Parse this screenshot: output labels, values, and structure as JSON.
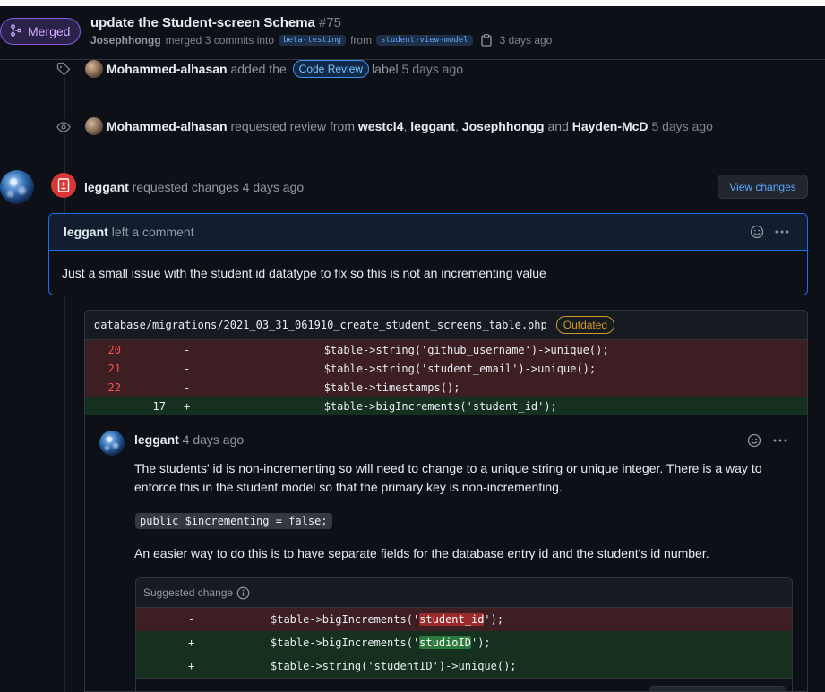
{
  "pr": {
    "state_label": "Merged",
    "title": "update the Student-screen Schema",
    "number": "#75",
    "author": "Josephhongg",
    "merge_text": "merged 3 commits into",
    "base_branch": "beta-testing",
    "from_text": "from",
    "head_branch": "student-view-model",
    "time": "3 days ago"
  },
  "events": [
    {
      "user": "Mohammed-alhasan",
      "action": "added the",
      "label": "Code Review",
      "suffix": "label",
      "time": "5 days ago",
      "icon": "tag-icon"
    },
    {
      "user": "Mohammed-alhasan",
      "action": "requested review from",
      "reviewers": [
        "westcl4",
        "leggant",
        "Josephhongg"
      ],
      "and_text": "and",
      "last_reviewer": "Hayden-McD",
      "time": "5 days ago",
      "icon": "eye-icon"
    }
  ],
  "review": {
    "user": "leggant",
    "action": "requested changes",
    "time": "4 days ago",
    "view_changes_label": "View changes",
    "comment": {
      "user": "leggant",
      "action": "left a comment",
      "body": "Just a small issue with the student id datatype to fix so this is not an incrementing value"
    }
  },
  "diff": {
    "file": "database/migrations/2021_03_31_061910_create_student_screens_table.php",
    "outdated_label": "Outdated",
    "lines": [
      {
        "type": "del",
        "old": "20",
        "new": "",
        "sign": "-",
        "code": "            $table->string('github_username')->unique();"
      },
      {
        "type": "del",
        "old": "21",
        "new": "",
        "sign": "-",
        "code": "            $table->string('student_email')->unique();"
      },
      {
        "type": "del",
        "old": "22",
        "new": "",
        "sign": "-",
        "code": "            $table->timestamps();"
      },
      {
        "type": "add",
        "old": "",
        "new": "17",
        "sign": "+",
        "code": "            $table->bigIncrements('student_id');"
      }
    ]
  },
  "thread": {
    "user": "leggant",
    "time": "4 days ago",
    "paragraph1": "The students' id is non-incrementing so will need to change to a unique string or unique integer. There is a way to enforce this in the student model so that the primary key is non-incrementing.",
    "code_snippet": "public $incrementing = false;",
    "paragraph2": "An easier way to do this is to have separate fields for the database entry id and the student's id number.",
    "suggested_label": "Suggested change",
    "suggestion": {
      "del": {
        "sign": "-",
        "pre": "$table->bigIncrements('",
        "hl": "student_id",
        "post": "');"
      },
      "add1": {
        "sign": "+",
        "pre": "$table->bigIncrements('",
        "hl": "studioID",
        "post": "');"
      },
      "add2": {
        "sign": "+",
        "code": "$table->string('studentID')->unique();"
      }
    }
  },
  "colors": {
    "merged": "#8957e5",
    "requested_changes": "#da3633",
    "link": "#58a6ff",
    "outdated": "#d29922"
  }
}
